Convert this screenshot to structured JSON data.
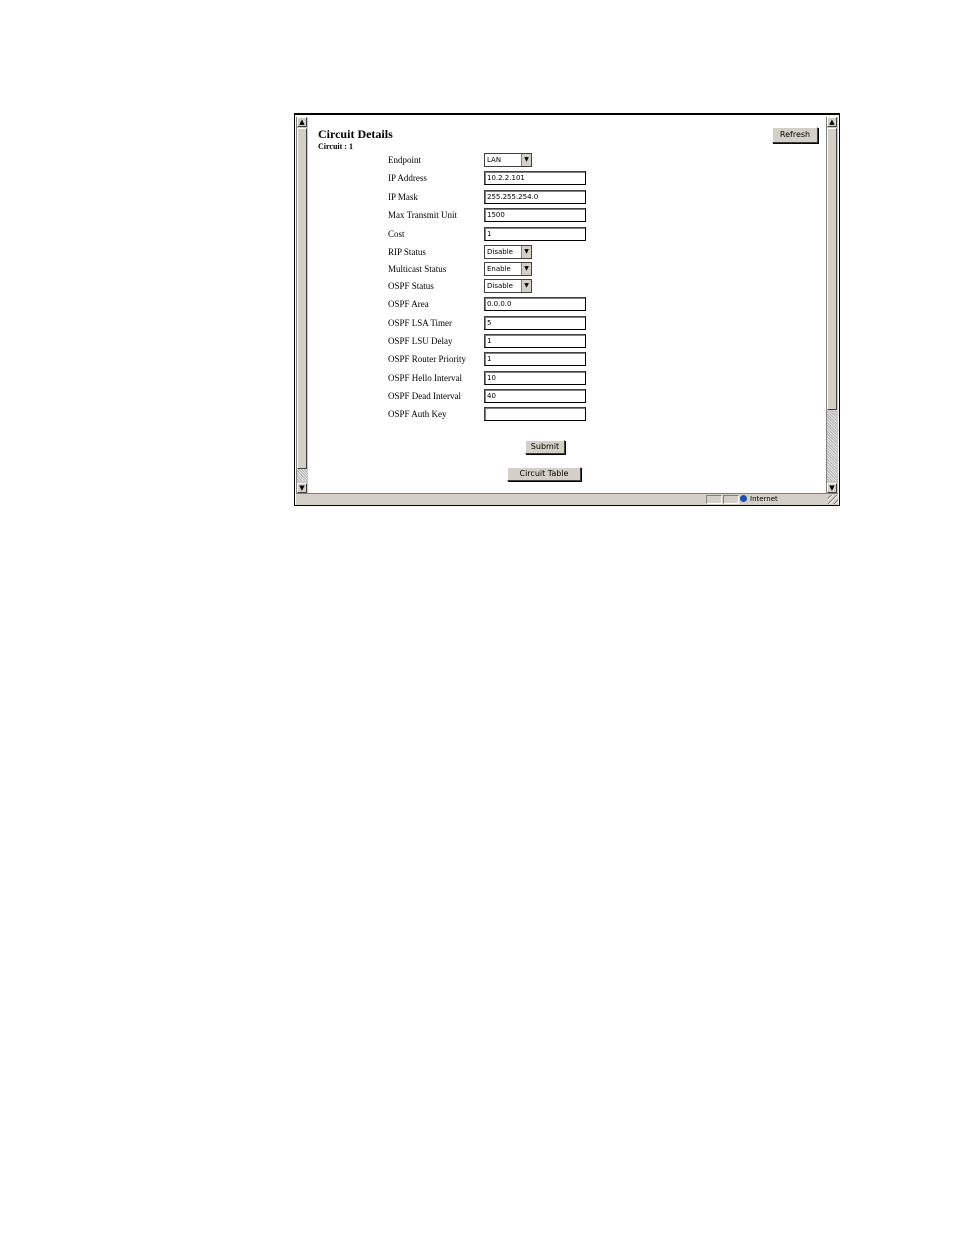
{
  "page": {
    "title": "Circuit Details",
    "subtitle": "Circuit : 1"
  },
  "buttons": {
    "refresh": "Refresh",
    "submit": "Submit",
    "circuit_table": "Circuit Table"
  },
  "fields": [
    {
      "label": "Endpoint",
      "type": "select",
      "value": "LAN"
    },
    {
      "label": "IP Address",
      "type": "text",
      "value": "10.2.2.101"
    },
    {
      "label": "IP Mask",
      "type": "text",
      "value": "255.255.254.0"
    },
    {
      "label": "Max Transmit Unit",
      "type": "text",
      "value": "1500"
    },
    {
      "label": "Cost",
      "type": "text",
      "value": "1"
    },
    {
      "label": "RIP Status",
      "type": "select",
      "value": "Disable"
    },
    {
      "label": "Multicast Status",
      "type": "select",
      "value": "Enable"
    },
    {
      "label": "OSPF Status",
      "type": "select",
      "value": "Disable"
    },
    {
      "label": "OSPF Area",
      "type": "text",
      "value": "0.0.0.0"
    },
    {
      "label": "OSPF LSA Timer",
      "type": "text",
      "value": "5"
    },
    {
      "label": "OSPF LSU Delay",
      "type": "text",
      "value": "1"
    },
    {
      "label": "OSPF Router Priority",
      "type": "text",
      "value": "1"
    },
    {
      "label": "OSPF Hello Interval",
      "type": "text",
      "value": "10"
    },
    {
      "label": "OSPF Dead Interval",
      "type": "text",
      "value": "40"
    },
    {
      "label": "OSPF Auth Key",
      "type": "text",
      "value": ""
    }
  ],
  "status_bar": {
    "zone": "Internet",
    "icon": "globe-icon"
  },
  "icons": {
    "scroll_up": "▲",
    "scroll_down": "▼",
    "dropdown": "▼"
  }
}
